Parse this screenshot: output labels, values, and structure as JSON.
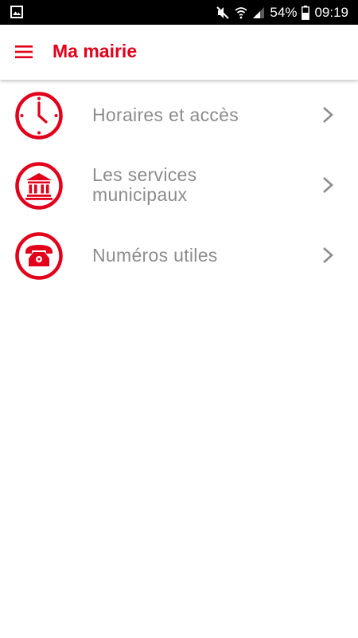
{
  "status_bar": {
    "battery": "54%",
    "time": "09:19"
  },
  "app_bar": {
    "title": "Ma mairie"
  },
  "menu": [
    {
      "label": "Horaires et accès",
      "icon": "clock-icon"
    },
    {
      "label": "Les services\nmunicipaux",
      "icon": "bank-building-icon"
    },
    {
      "label": "Numéros utiles",
      "icon": "telephone-icon"
    }
  ],
  "colors": {
    "accent": "#e2001a",
    "label": "#8c8c8c",
    "chevron": "#8c8c8c"
  }
}
